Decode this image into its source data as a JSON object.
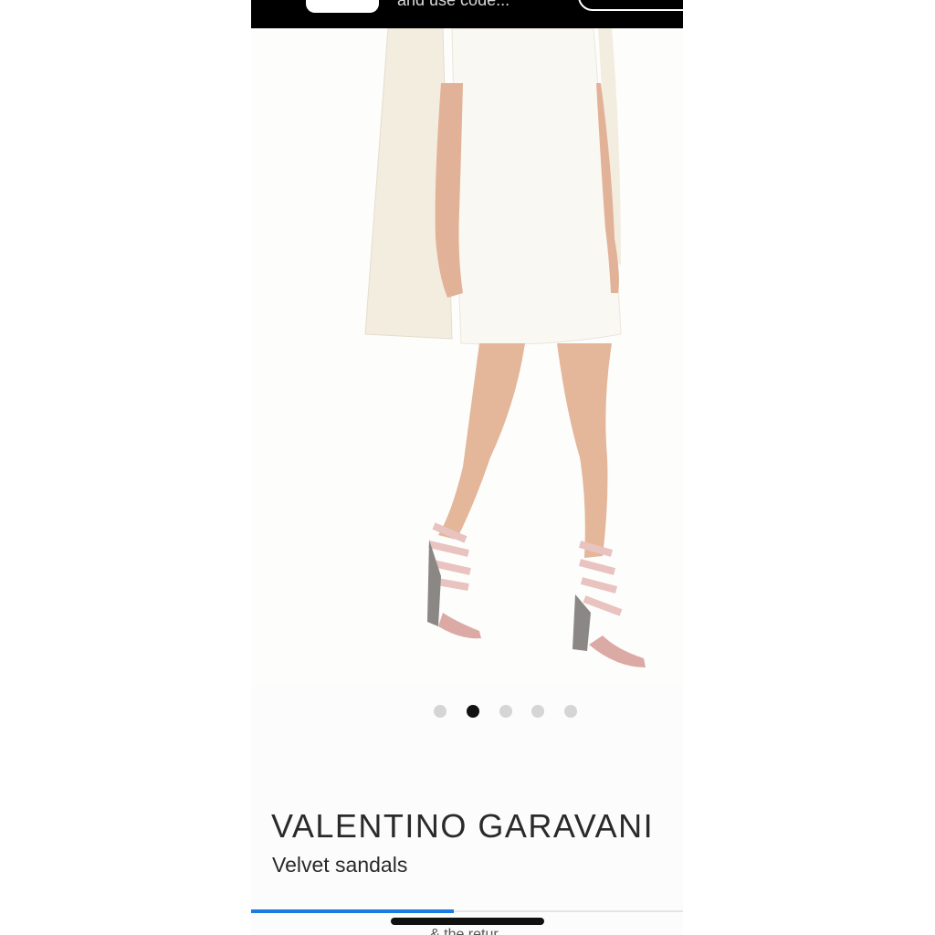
{
  "banner": {
    "text": "and use code...",
    "colors": {
      "background": "#000000",
      "pill": "#ffffff"
    }
  },
  "product": {
    "brand": "VALENTINO GARAVANI",
    "name": "Velvet sandals"
  },
  "gallery": {
    "image_count": 5,
    "active_index": 1
  },
  "progress": {
    "fraction": 0.47,
    "color": "#1a7ce0"
  },
  "footer": {
    "partial_text": "& the retur..."
  },
  "colors": {
    "brand_text": "#2a2a2a",
    "dot_inactive": "#d5d5d5",
    "dot_active": "#111111"
  }
}
